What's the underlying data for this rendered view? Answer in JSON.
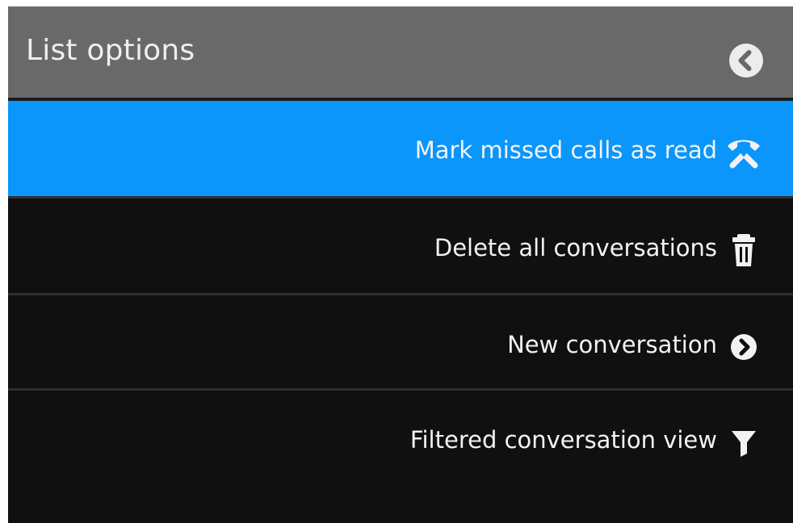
{
  "header": {
    "title": "List options",
    "back_icon": "chevron-left-circle-icon"
  },
  "menu": {
    "items": [
      {
        "label": "Mark missed calls as read",
        "icon": "phone-hangup-icon",
        "selected": true
      },
      {
        "label": "Delete all conversations",
        "icon": "trash-icon",
        "selected": false
      },
      {
        "label": "New conversation",
        "icon": "chevron-right-circle-icon",
        "selected": false
      },
      {
        "label": "Filtered conversation view",
        "icon": "filter-icon",
        "selected": false
      }
    ]
  },
  "colors": {
    "header_bg": "#696969",
    "selected_bg": "#0a96fb",
    "panel_bg": "#101010",
    "text": "#f2f2f2"
  }
}
